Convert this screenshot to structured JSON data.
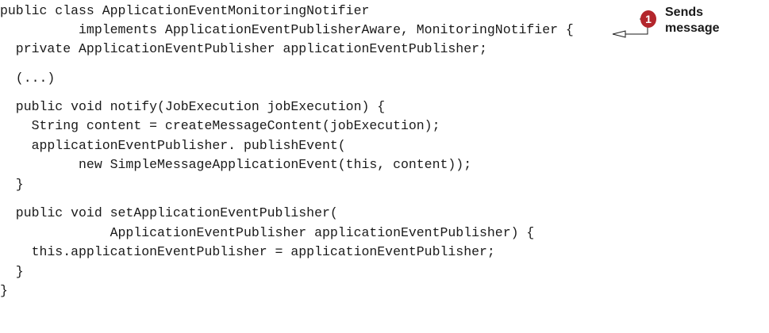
{
  "code": {
    "lines": [
      "public class ApplicationEventMonitoringNotifier",
      "          implements ApplicationEventPublisherAware, MonitoringNotifier {",
      "  private ApplicationEventPublisher applicationEventPublisher;",
      "  (...)",
      "  public void notify(JobExecution jobExecution) {",
      "    String content = createMessageContent(jobExecution);",
      "    applicationEventPublisher. publishEvent(",
      "          new SimpleMessageApplicationEvent(this, content));",
      "  }",
      "  public void setApplicationEventPublisher(",
      "              ApplicationEventPublisher applicationEventPublisher) {",
      "    this.applicationEventPublisher = applicationEventPublisher;",
      "  }",
      "}"
    ]
  },
  "annotation": {
    "number": "1",
    "line1": "Sends",
    "line2": "message",
    "accent_color": "#b3262c"
  }
}
